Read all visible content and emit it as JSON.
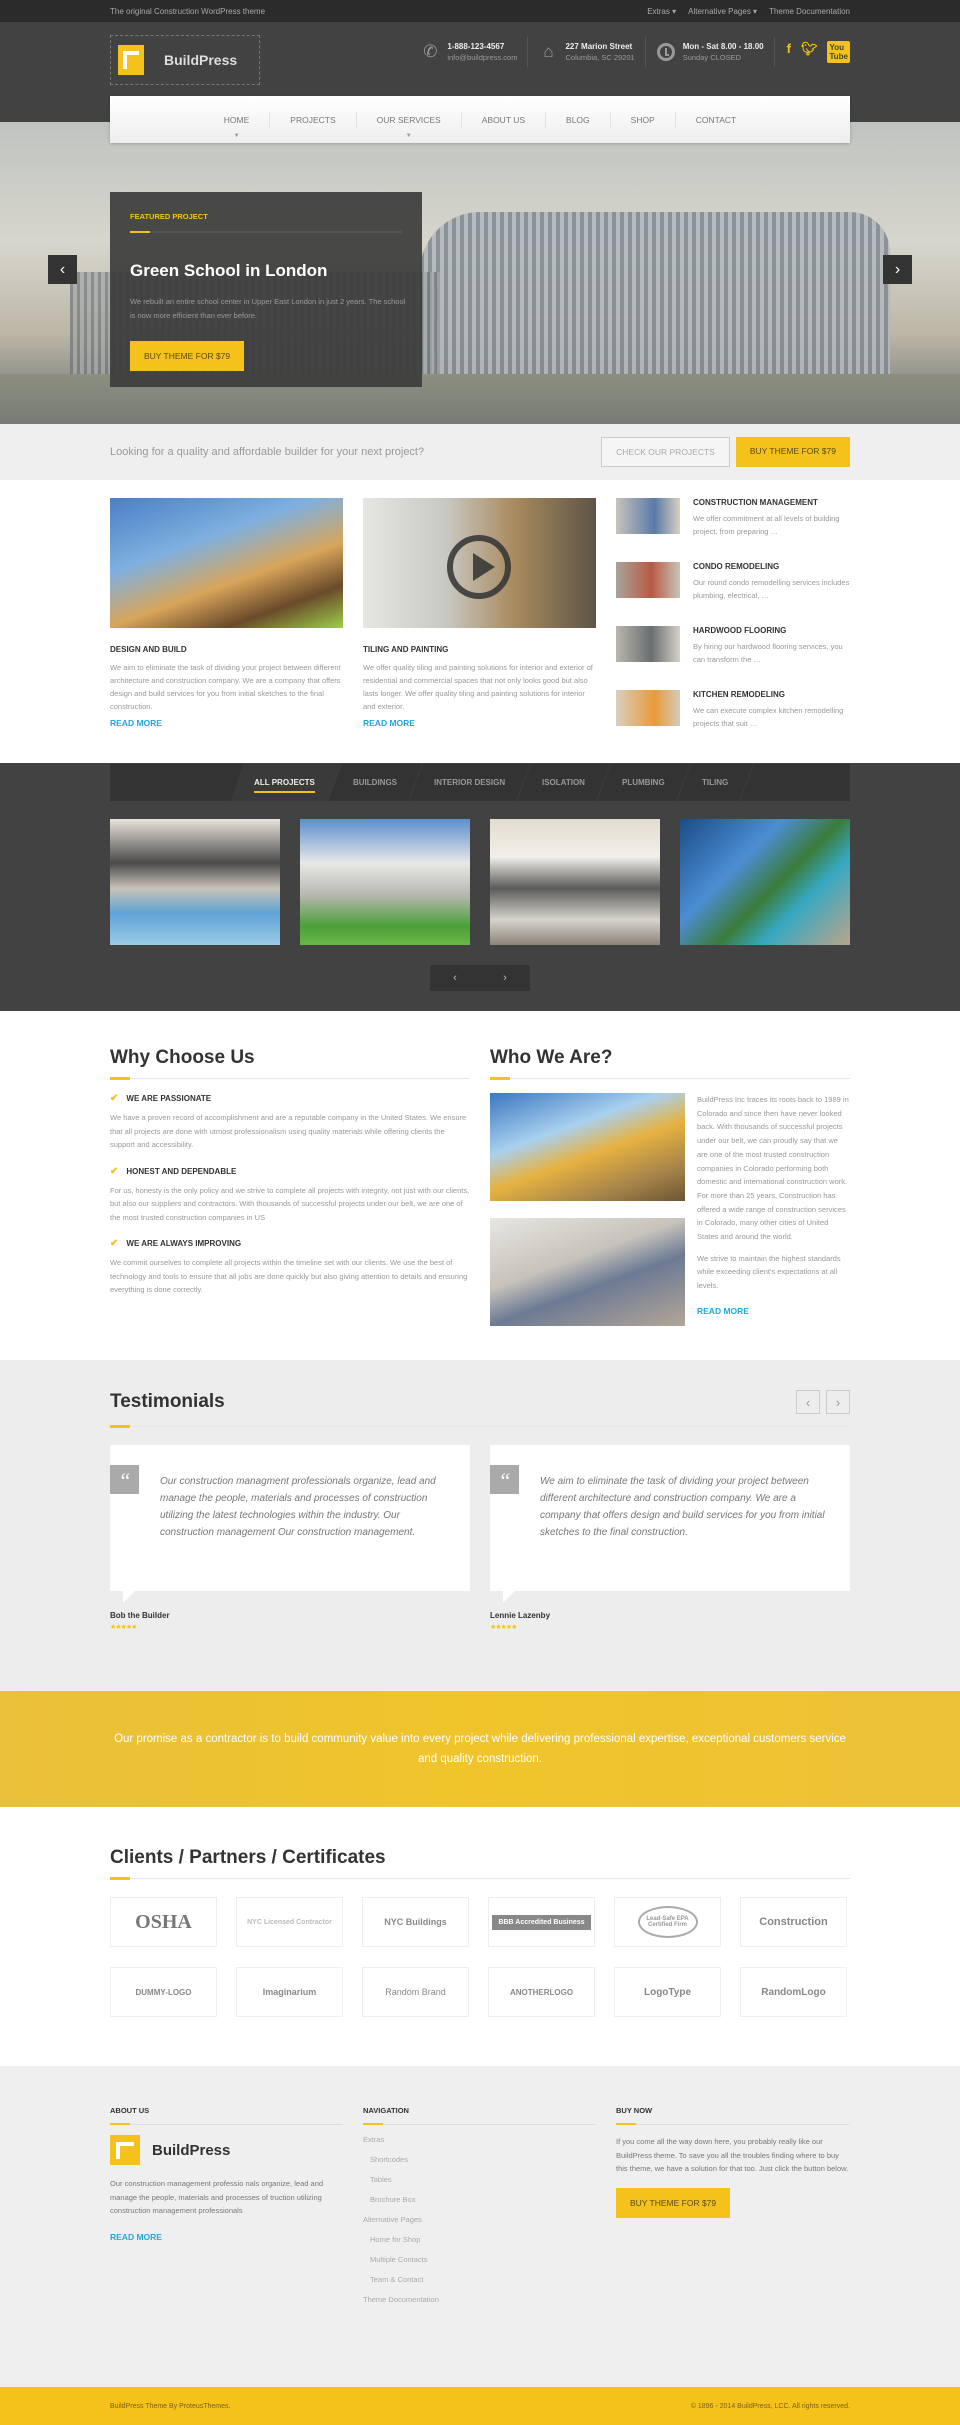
{
  "topbar": {
    "tagline": "The original Construction WordPress theme",
    "links": [
      "Extras ▾",
      "Alternative Pages ▾",
      "Theme Documentation"
    ]
  },
  "header": {
    "logo_text": "BuildPress",
    "contacts": [
      {
        "icon": "phone-icon",
        "line1": "1-888-123-4567",
        "line2": "info@buildpress.com"
      },
      {
        "icon": "home-icon",
        "line1": "227 Marion Street",
        "line2": "Columbia, SC 29201"
      },
      {
        "icon": "clock-icon",
        "line1": "Mon - Sat 8.00 - 18.00",
        "line2": "Sunday CLOSED"
      }
    ],
    "social": [
      "f",
      "t",
      "yt"
    ]
  },
  "nav": {
    "items": [
      "HOME",
      "PROJECTS",
      "OUR SERVICES",
      "ABOUT US",
      "BLOG",
      "SHOP",
      "CONTACT"
    ]
  },
  "hero": {
    "label": "FEATURED PROJECT",
    "title": "Green School in London",
    "text": "We rebuilt an entire school center in Upper East London in just 2 years. The school is now more efficient than ever before.",
    "button": "BUY THEME FOR $79",
    "prev": "‹",
    "next": "›"
  },
  "cta": {
    "question": "Looking for a quality and affordable builder for your next project?",
    "btn_projects": "CHECK OUR PROJECTS",
    "btn_buy": "BUY THEME FOR $79"
  },
  "services": {
    "cards": [
      {
        "title": "DESIGN AND BUILD",
        "text": "We aim to eliminate the task of dividing your project between different architecture and construction company. We are a company that offers design and build services for you from initial sketches to the final construction.",
        "link": "READ MORE"
      },
      {
        "title": "TILING AND PAINTING",
        "text": "We offer quality tiling and painting solutions for interior and exterior of residential and commercial spaces that not only looks good but also lasts longer. We offer quality tiling and painting solutions for interior and exterior.",
        "link": "READ MORE"
      }
    ],
    "list": [
      {
        "title": "CONSTRUCTION MANAGEMENT",
        "text": "We offer commitment at all levels of building project, from preparing …"
      },
      {
        "title": "CONDO REMODELING",
        "text": "Our round condo remodelling services includes plumbing, electrical, …"
      },
      {
        "title": "HARDWOOD FLOORING",
        "text": "By hiring our hardwood flooring services, you can transform the …"
      },
      {
        "title": "KITCHEN REMODELING",
        "text": "We can execute complex kitchen remodelling projects that suit …"
      }
    ]
  },
  "projects": {
    "tabs": [
      "ALL PROJECTS",
      "BUILDINGS",
      "INTERIOR DESIGN",
      "ISOLATION",
      "PLUMBING",
      "TILING"
    ],
    "prev": "‹",
    "next": "›"
  },
  "why": {
    "title": "Why Choose Us",
    "items": [
      {
        "title": "WE ARE PASSIONATE",
        "text": "We have a proven record of accomplishment and are a reputable company in the United States. We ensure that all projects are done with utmost professionalism using quality materials while offering clients the support and accessibility."
      },
      {
        "title": "HONEST AND DEPENDABLE",
        "text": "For us, honesty is the only policy and we strive to complete all projects with integrity, not just with our clients, but also our suppliers and contractors. With thousands of successful projects under our belt, we are one of the most trusted construction companies in US"
      },
      {
        "title": "WE ARE ALWAYS IMPROVING",
        "text": "We commit ourselves to complete all projects within the timeline set with our clients. We use the best of technology and tools to ensure that all jobs are done quickly but also giving attention to details and ensuring everything is done correctly."
      }
    ]
  },
  "who": {
    "title": "Who We Are?",
    "p1": "BuildPress Inc traces its roots back to 1989 in Colorado and since then have never looked back. With thousands of successful projects under our belt, we can proudly say that we are one of the most trusted construction companies in Colorado performing both domestic and international construction work. For more than 25 years, Construction has offered a wide range of construction services in Colorado, many other cities of United States and around the world.",
    "p2": "We strive to maintain the highest standards while exceeding client's expectations at all levels.",
    "link": "READ MORE"
  },
  "testimonials": {
    "title": "Testimonials",
    "prev": "‹",
    "next": "›",
    "items": [
      {
        "quote": "Our construction managment professionals organize, lead and manage the people, materials and processes of construction utilizing the latest technologies within the industry. Our construction management Our construction management.",
        "author": "Bob the Builder",
        "stars": "★★★★★",
        "rating": 5
      },
      {
        "quote": "We aim to eliminate the task of dividing your project between different architecture and construction company. We are a company that offers design and build services for you from initial sketches to the final construction.",
        "author": "Lennie Lazenby",
        "stars": "★★★★★",
        "rating": 5
      }
    ]
  },
  "promise": {
    "text": "Our promise as a contractor is to build community value into every project while delivering professional expertise, exceptional customers service and quality construction."
  },
  "clients": {
    "title": "Clients / Partners / Certificates",
    "logos": [
      "OSHA",
      "NYC Licensed Contractor",
      "NYC Buildings",
      "BBB Accredited Business",
      "Lead-Safe EPA Certified Firm",
      "Construction",
      "DUMMY-LOGO",
      "Imaginarium",
      "Random Brand",
      "ANOTHERLOGO",
      "LogoType",
      "RandomLogo"
    ]
  },
  "footer": {
    "about": {
      "heading": "ABOUT US",
      "logo_text": "BuildPress",
      "text": "Our construction management professio nals organize, lead and manage the people, materials and processes of truction utilizing construction management professionals",
      "link": "READ MORE"
    },
    "navigation": {
      "heading": "NAVIGATION",
      "items": [
        {
          "label": "Extras",
          "sub": false
        },
        {
          "label": "Shortcodes",
          "sub": true
        },
        {
          "label": "Tables",
          "sub": true
        },
        {
          "label": "Brochure Box",
          "sub": true
        },
        {
          "label": "Alternative Pages",
          "sub": false
        },
        {
          "label": "Home for Shop",
          "sub": true
        },
        {
          "label": "Multiple Contacts",
          "sub": true
        },
        {
          "label": "Team & Contact",
          "sub": true
        },
        {
          "label": "Theme Documentation",
          "sub": false
        }
      ]
    },
    "buy": {
      "heading": "BUY NOW",
      "text": "If you come all the way down here, you probably really like our BuildPress theme. To save you all the troubles finding where to buy this theme, we have a solution for that too. Just click the button below.",
      "button": "BUY THEME FOR $79"
    }
  },
  "copyright": {
    "left": "BuildPress Theme By ProteusThemes.",
    "right": "© 1896 - 2014 BuildPress, LCC. All rights reserved."
  }
}
